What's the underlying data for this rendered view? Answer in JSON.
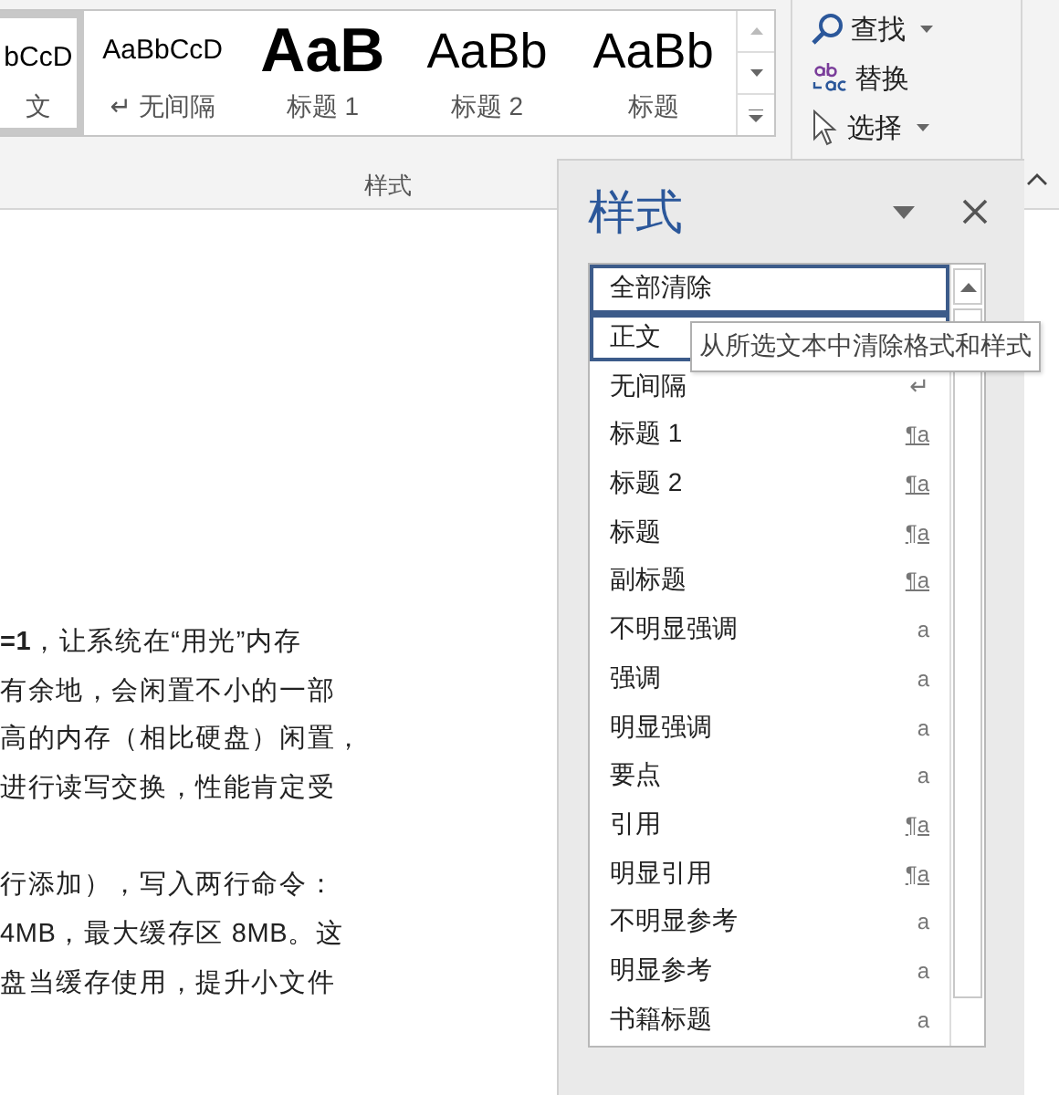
{
  "ribbon": {
    "gallery": [
      {
        "preview": "bCcD",
        "label": "文",
        "kind": "normal",
        "selected": true
      },
      {
        "preview": "AaBbCcD",
        "label": "无间隔",
        "mark": "↵",
        "kind": "normal",
        "selected": false
      },
      {
        "preview": "AaB",
        "label": "标题 1",
        "kind": "heading1",
        "selected": false
      },
      {
        "preview": "AaBb",
        "label": "标题 2",
        "kind": "heading2",
        "selected": false
      },
      {
        "preview": "AaBb",
        "label": "标题",
        "kind": "title",
        "selected": false
      }
    ],
    "group_label": "样式",
    "editing": [
      {
        "label": "查找",
        "kind": "search",
        "dropdown": true
      },
      {
        "label": "替换",
        "kind": "replace",
        "dropdown": false
      },
      {
        "label": "选择",
        "kind": "select",
        "dropdown": true
      }
    ]
  },
  "document": {
    "paragraphs": [
      {
        "lines": [
          "**=1**，让系统在“用光”内存",
          "有余地，会闲置不小的一部",
          "高的内存（相比硬盘）闲置，",
          "进行读写交换，性能肯定受"
        ]
      },
      {
        "lines": [
          "行添加），写入两行命令：",
          "4MB，最大缓存区 8MB。这",
          "盘当缓存使用，提升小文件"
        ]
      }
    ]
  },
  "styles_pane": {
    "title": "样式",
    "items": [
      {
        "name": "全部清除",
        "kind": "none",
        "highlighted": true
      },
      {
        "name": "正文",
        "kind": "none",
        "highlighted": true
      },
      {
        "name": "无间隔",
        "kind": "para",
        "marker": "↵",
        "highlighted": false
      },
      {
        "name": "标题 1",
        "kind": "linked",
        "marker": "¶a",
        "highlighted": false
      },
      {
        "name": "标题 2",
        "kind": "linked",
        "marker": "¶a",
        "highlighted": false
      },
      {
        "name": "标题",
        "kind": "linked",
        "marker": "¶a",
        "highlighted": false
      },
      {
        "name": "副标题",
        "kind": "linked",
        "marker": "¶a",
        "highlighted": false
      },
      {
        "name": "不明显强调",
        "kind": "char",
        "marker": "a",
        "highlighted": false
      },
      {
        "name": "强调",
        "kind": "char",
        "marker": "a",
        "highlighted": false
      },
      {
        "name": "明显强调",
        "kind": "char",
        "marker": "a",
        "highlighted": false
      },
      {
        "name": "要点",
        "kind": "char",
        "marker": "a",
        "highlighted": false
      },
      {
        "name": "引用",
        "kind": "linked",
        "marker": "¶a",
        "highlighted": false
      },
      {
        "name": "明显引用",
        "kind": "linked",
        "marker": "¶a",
        "highlighted": false
      },
      {
        "name": "不明显参考",
        "kind": "char",
        "marker": "a",
        "highlighted": false
      },
      {
        "name": "明显参考",
        "kind": "char",
        "marker": "a",
        "highlighted": false
      },
      {
        "name": "书籍标题",
        "kind": "char",
        "marker": "a",
        "highlighted": false
      }
    ],
    "tooltip": "从所选文本中清除格式和样式"
  }
}
